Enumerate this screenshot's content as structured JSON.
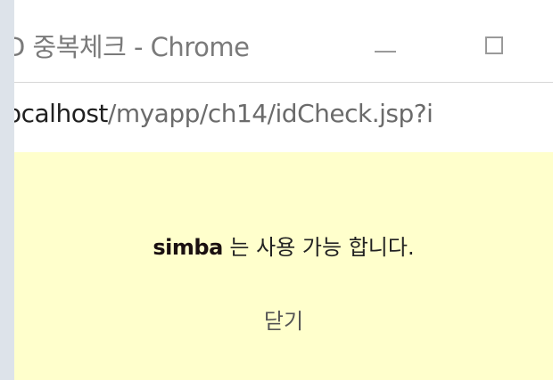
{
  "window": {
    "title": "D 중복체크 - Chrome",
    "minimize_symbol": "minimize-icon",
    "maximize_symbol": "maximize-icon"
  },
  "address": {
    "host": "ocalhost",
    "path": "/myapp/ch14/idCheck.jsp?i"
  },
  "content": {
    "background": "#ffffcc",
    "user_id": "simba",
    "message_suffix": " 는 사용 가능 합니다.",
    "close_label": "닫기"
  }
}
